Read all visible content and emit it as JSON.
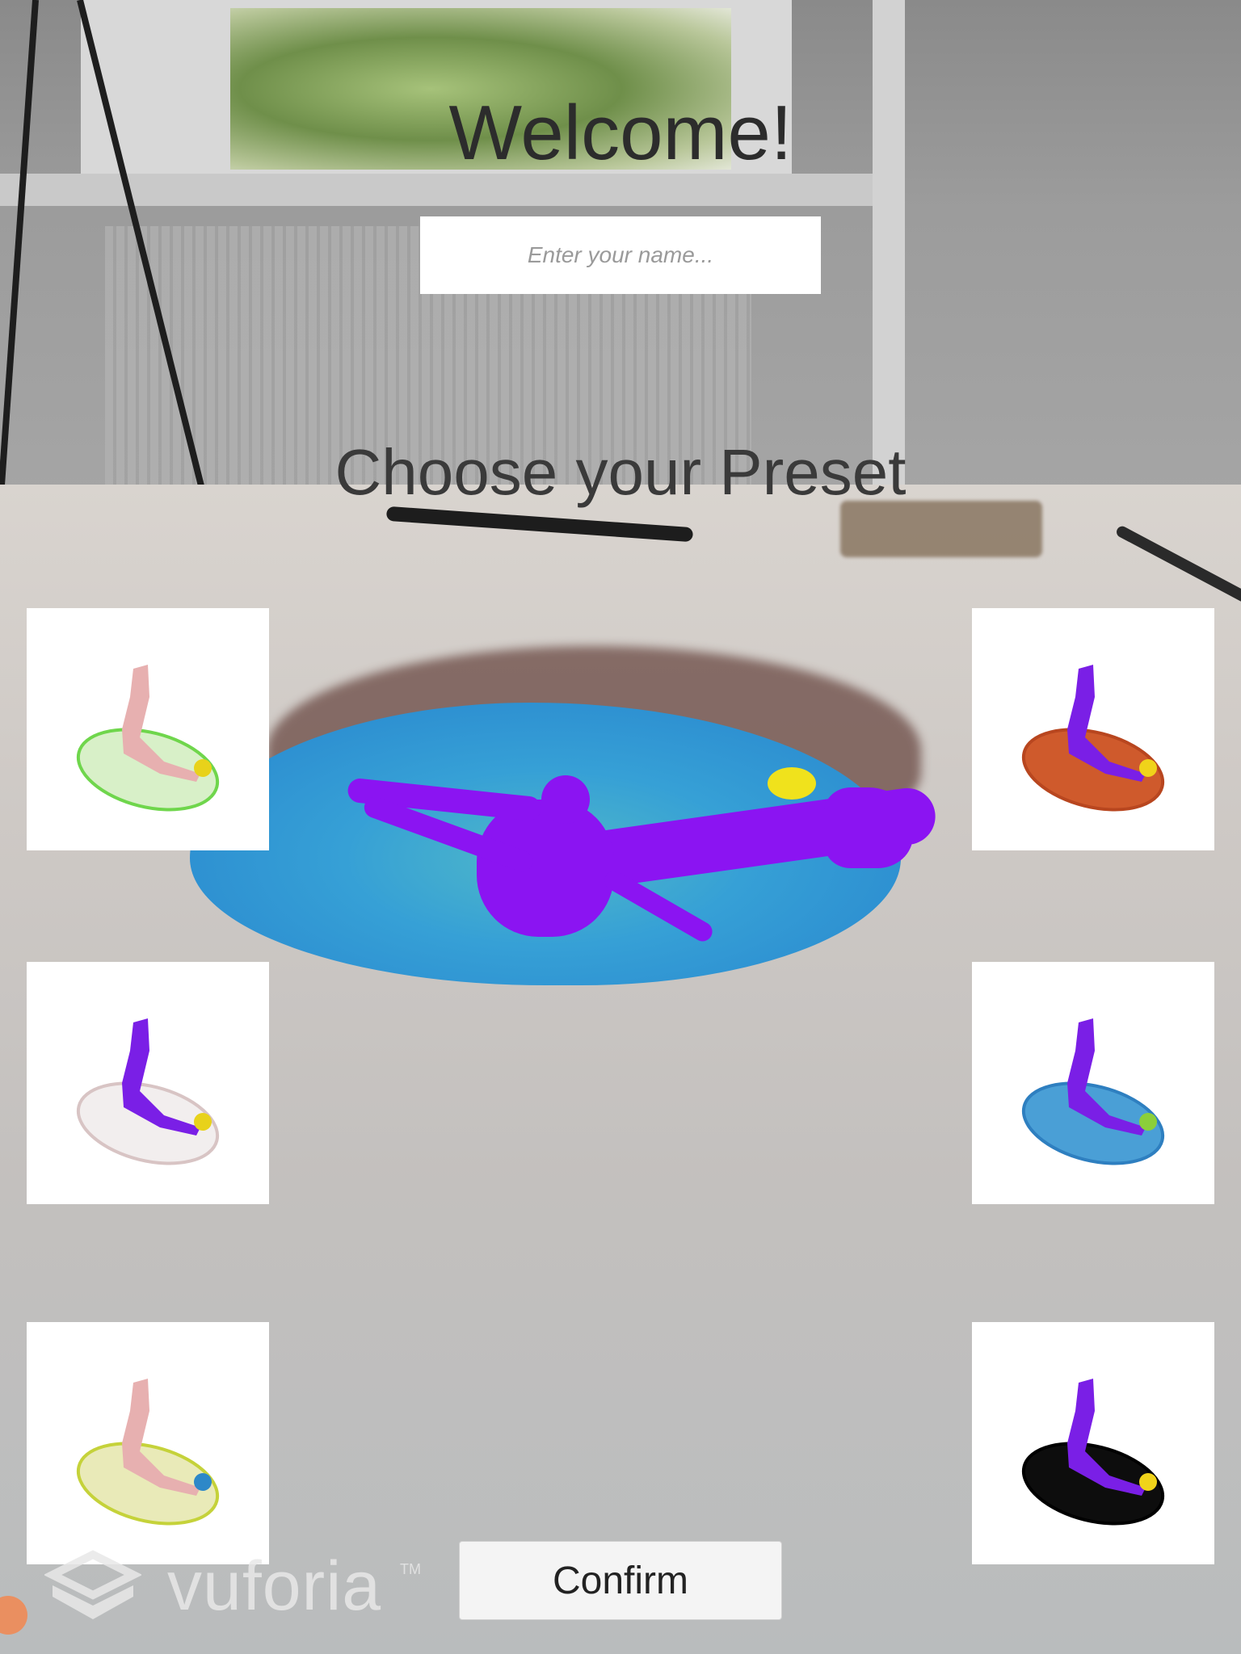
{
  "screen": {
    "welcome_title": "Welcome!",
    "name_input": {
      "placeholder": "Enter your name...",
      "value": ""
    },
    "preset_title": "Choose your Preset",
    "confirm_label": "Confirm"
  },
  "branding": {
    "logo_text": "vuforia",
    "logo_tm": "TM",
    "logo_icon": "vuforia-cube-icon"
  },
  "presets": [
    {
      "name": "preset-1",
      "organ_color": "#d8f0c8",
      "rim_color": "#6fd64c",
      "vessel_color": "#e7b0b0",
      "dot_color": "#e8d21a"
    },
    {
      "name": "preset-2",
      "organ_color": "#cf5a2c",
      "rim_color": "#b8461f",
      "vessel_color": "#7a1fe6",
      "dot_color": "#f0d31a"
    },
    {
      "name": "preset-3",
      "organ_color": "#f2eeee",
      "rim_color": "#d8c4c4",
      "vessel_color": "#7a1fe6",
      "dot_color": "#e8d21a"
    },
    {
      "name": "preset-4",
      "organ_color": "#4a9fd6",
      "rim_color": "#2e7fc0",
      "vessel_color": "#7a1fe6",
      "dot_color": "#8bcf3a"
    },
    {
      "name": "preset-5",
      "organ_color": "#e9eab8",
      "rim_color": "#c5d23a",
      "vessel_color": "#e7b0b0",
      "dot_color": "#2d88c8"
    },
    {
      "name": "preset-6",
      "organ_color": "#0d0d0d",
      "rim_color": "#000000",
      "vessel_color": "#7a1fe6",
      "dot_color": "#f0d31a"
    }
  ],
  "colors": {
    "accent_vessel": "#8b14f2",
    "organ_blue": "#2d8fd1",
    "marker_yellow": "#f0e21c"
  }
}
